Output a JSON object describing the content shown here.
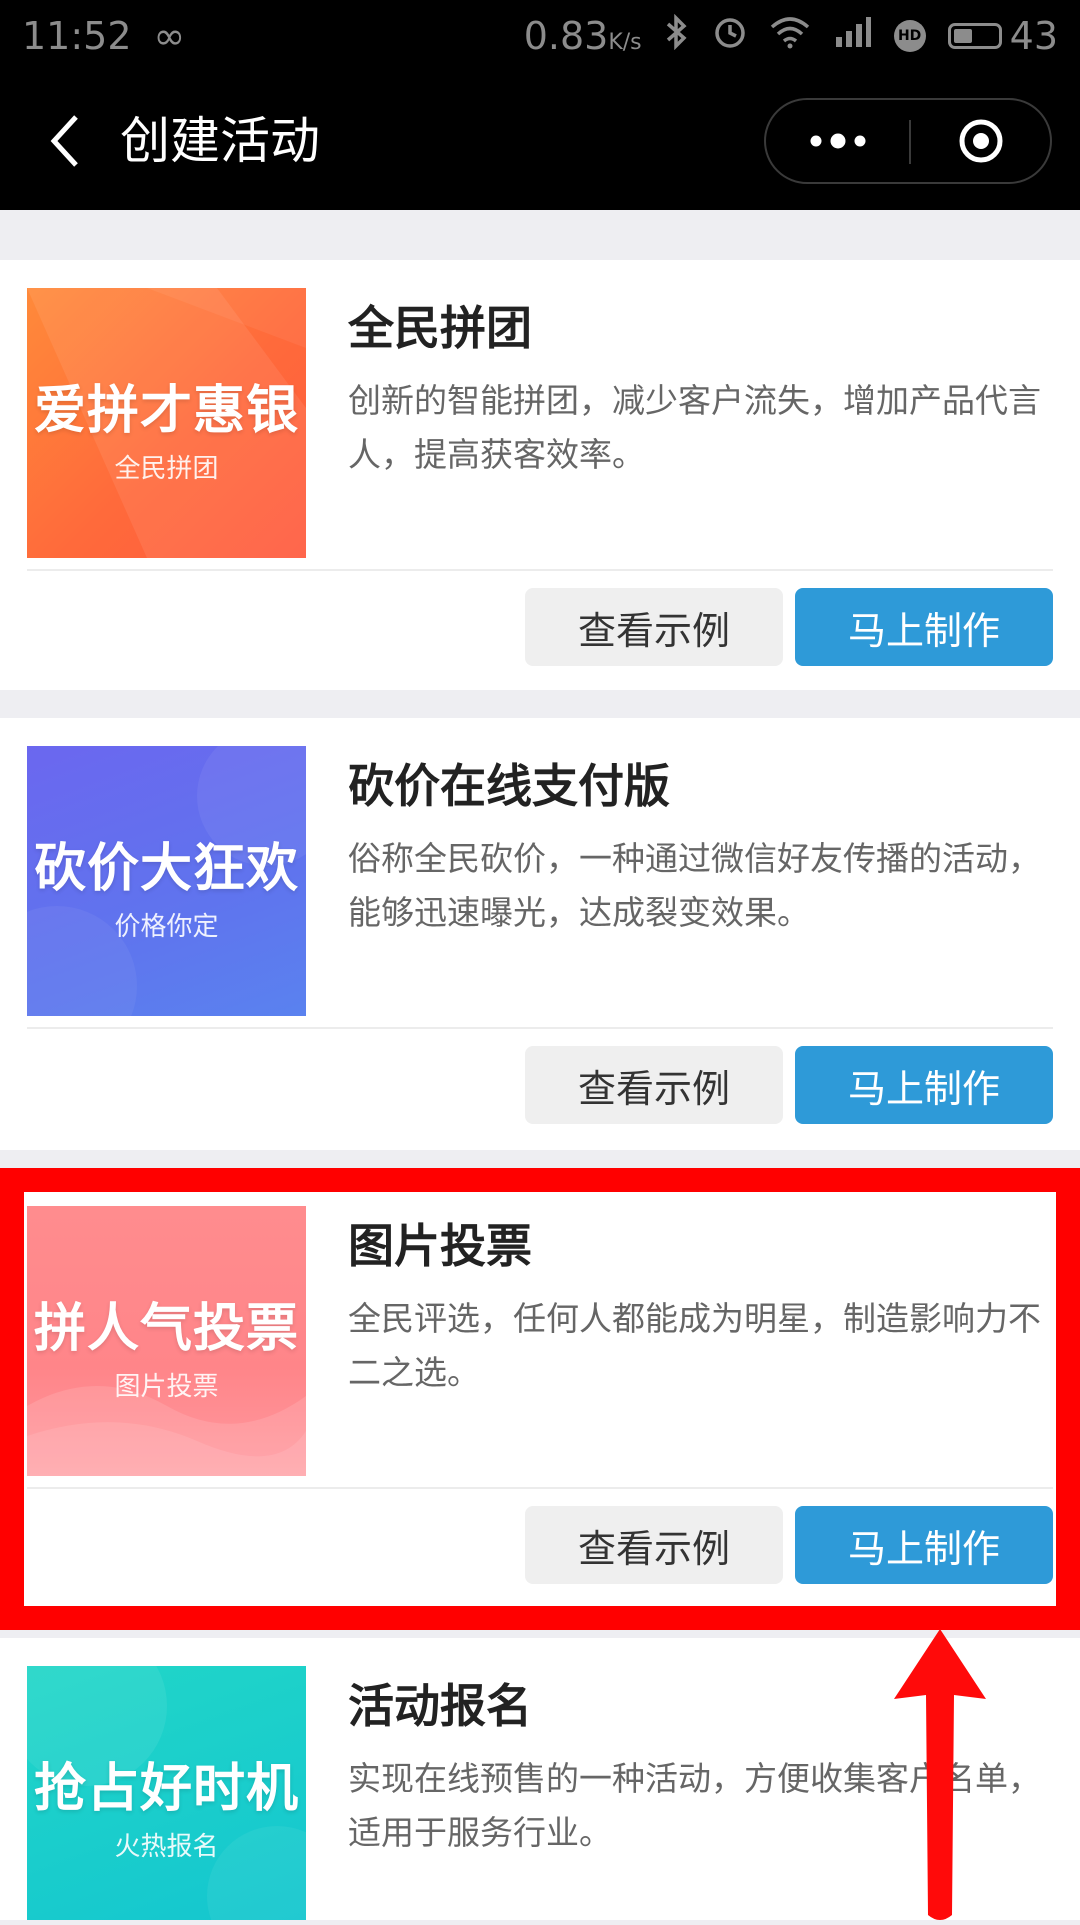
{
  "status_bar": {
    "time": "11:52",
    "infinity_symbol": "∞",
    "speed": "0.83",
    "speed_unit": "K/s",
    "battery": "43",
    "hd_label": "HD"
  },
  "nav": {
    "title": "创建活动"
  },
  "cards": [
    {
      "thumb_main": "爱拼才惠银",
      "thumb_sub": "全民拼团",
      "thumb_colors": [
        "#ff7a33",
        "#ff5c3a"
      ],
      "title": "全民拼团",
      "desc": "创新的智能拼团，减少客户流失，增加产品代言人，提高获客效率。",
      "view_label": "查看示例",
      "make_label": "马上制作"
    },
    {
      "thumb_main": "砍价大狂欢",
      "thumb_sub": "价格你定",
      "thumb_colors": [
        "#6a6df0",
        "#5b78ee"
      ],
      "title": "砍价在线支付版",
      "desc": "俗称全民砍价，一种通过微信好友传播的活动，能够迅速曝光，达成裂变效果。",
      "view_label": "查看示例",
      "make_label": "马上制作"
    },
    {
      "thumb_main": "拼人气投票",
      "thumb_sub": "图片投票",
      "thumb_colors": [
        "#ff8f8f",
        "#ff7b86"
      ],
      "title": "图片投票",
      "desc": "全民评选，任何人都能成为明星，制造影响力不二之选。",
      "view_label": "查看示例",
      "make_label": "马上制作"
    },
    {
      "thumb_main": "抢占好时机",
      "thumb_sub": "火热报名",
      "thumb_colors": [
        "#1fd3c9",
        "#12c4cf"
      ],
      "title": "活动报名",
      "desc": "实现在线预售的一种活动，方便收集客户名单，适用于服务行业。"
    }
  ],
  "colors": {
    "primary_button": "#2e9ad8",
    "highlight": "#ff0000",
    "background": "#eeeef2"
  }
}
